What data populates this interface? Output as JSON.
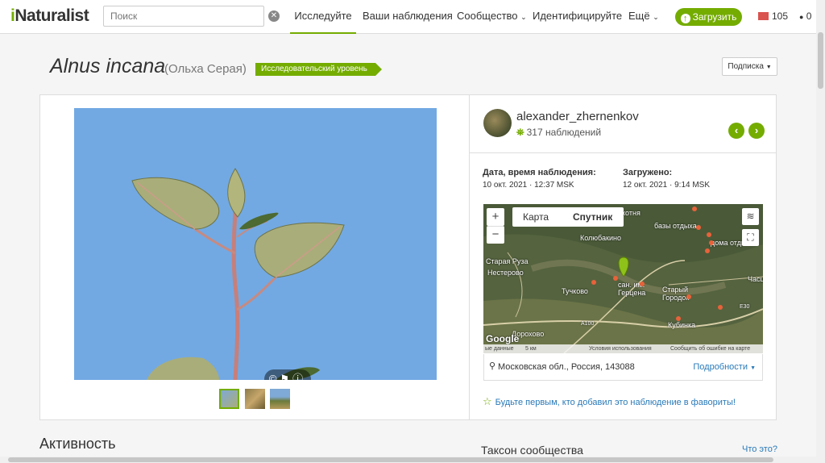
{
  "header": {
    "logo_prefix": "i",
    "logo_rest": "Naturalist",
    "search_placeholder": "Поиск",
    "nav": [
      "Исследуйте",
      "Ваши наблюдения",
      "Сообщество",
      "Идентифицируйте",
      "Ещё"
    ],
    "upload": "Загрузить",
    "messages": "105",
    "notifications": "0",
    "accent": "#74ac00"
  },
  "title": {
    "scientific": "Alnus incana",
    "common": "(Ольха Серая)",
    "grade": "Исследовательский уровень",
    "subscribe": "Подписка"
  },
  "observer": {
    "username": "alexander_zhernenkov",
    "observations": "317 наблюдений"
  },
  "details": {
    "observed_label": "Дата, время наблюдения:",
    "observed_value": "10 окт. 2021 · 12:37 MSK",
    "uploaded_label": "Загружено:",
    "uploaded_value": "12 окт. 2021 · 9:14 MSK"
  },
  "map": {
    "tab_map": "Карта",
    "tab_satellite": "Спутник",
    "labels": [
      "Старая Руза",
      "Нестерово",
      "Колюбакино",
      "Тучково",
      "сан. им. Герцена",
      "Старый Городок",
      "Кубинка",
      "Дорохово",
      "базы отдыха",
      "дома отдыха",
      "Часц",
      "котня"
    ],
    "road_a100": "A100",
    "road_e30": "E30",
    "footer_data": "ые данные",
    "footer_scale": "5 км",
    "footer_terms": "Условия использования",
    "footer_report": "Сообщить об ошибке на карте",
    "google": "Google"
  },
  "location": {
    "place": "Московская обл., Россия, 143088",
    "more": "Подробности"
  },
  "favorite": "Будьте первым, кто добавил это наблюдение в фавориты!",
  "activity": "Активность",
  "taxon": "Таксон сообщества",
  "whatsthis": "Что это?"
}
